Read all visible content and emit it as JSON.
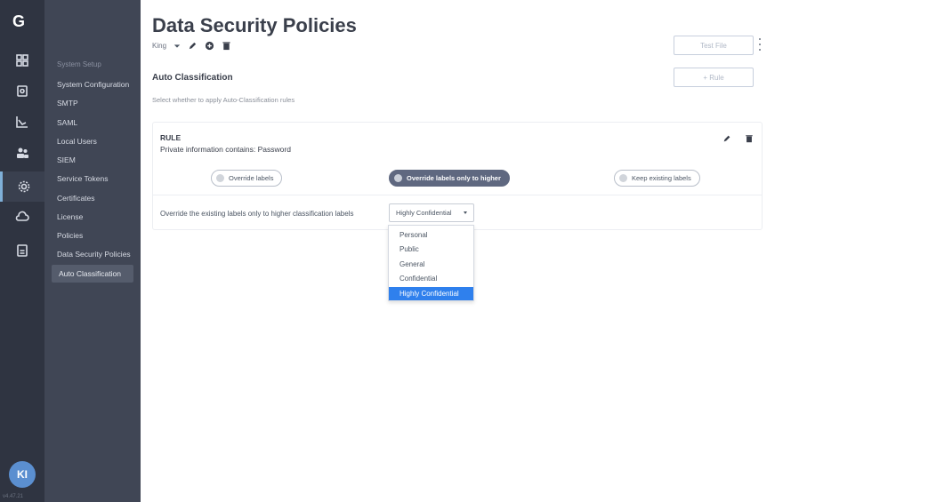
{
  "rail": {
    "logo": "G",
    "items": [
      {
        "icon": "grid-icon"
      },
      {
        "icon": "clipboard-icon"
      },
      {
        "icon": "chart-icon"
      },
      {
        "icon": "users-icon"
      },
      {
        "icon": "gear-icon",
        "active": true
      },
      {
        "icon": "cloud-icon"
      },
      {
        "icon": "report-icon"
      }
    ],
    "avatar_initials": "KI",
    "version": "v4.47.21"
  },
  "subnav": {
    "group_label": "System Setup",
    "items": [
      "System Configuration",
      "SMTP",
      "SAML",
      "Local Users",
      "SIEM",
      "Service Tokens",
      "Certificates",
      "License",
      "Policies",
      "Data Security Policies",
      "Auto Classification"
    ],
    "selected": "Auto Classification"
  },
  "header": {
    "title": "Data Security Policies",
    "user": "King",
    "test_file_label": "Test File",
    "add_rule_label": "+ Rule"
  },
  "section": {
    "title": "Auto Classification",
    "subtitle": "Select whether to apply Auto-Classification rules"
  },
  "rule": {
    "label": "RULE",
    "description": "Private information contains: Password",
    "options": [
      {
        "label": "Override labels",
        "active": false
      },
      {
        "label": "Override labels only to higher",
        "active": true
      },
      {
        "label": "Keep existing labels",
        "active": false
      }
    ],
    "override_text": "Override the existing labels only to higher classification labels",
    "selected_label": "Highly Confidential"
  },
  "dropdown": {
    "options": [
      "Personal",
      "Public",
      "General",
      "Confidential",
      "Highly Confidential"
    ],
    "selected": "Highly Confidential"
  },
  "colors": {
    "rail_bg": "#2f3441",
    "subnav_bg": "#404655",
    "accent": "#2f80ed",
    "active_pill": "#5f6880"
  }
}
